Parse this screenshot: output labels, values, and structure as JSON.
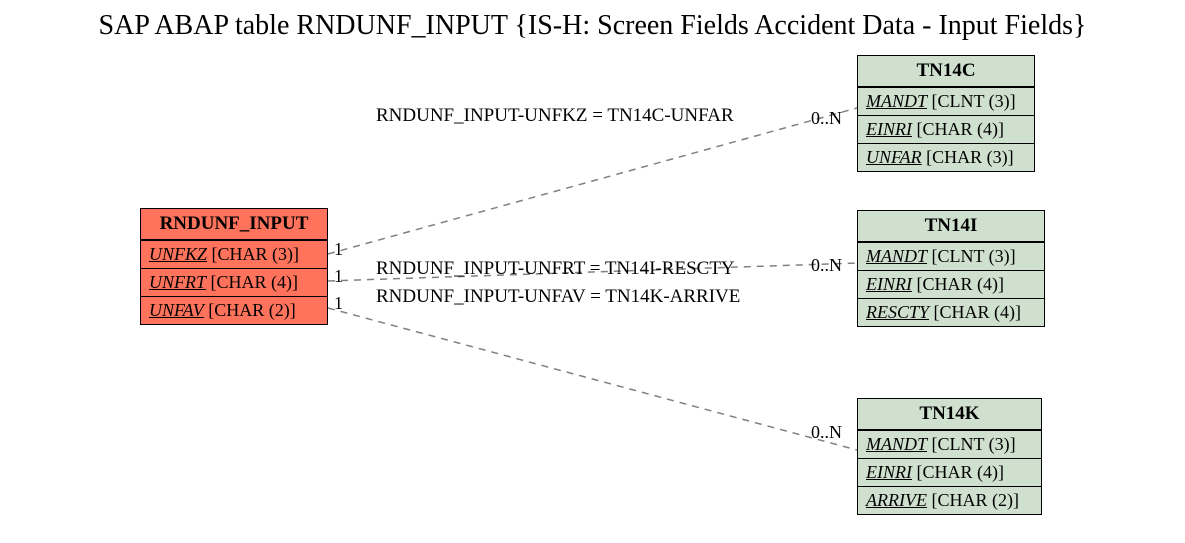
{
  "title": "SAP ABAP table RNDUNF_INPUT {IS-H: Screen Fields Accident Data - Input Fields}",
  "source": {
    "name": "RNDUNF_INPUT",
    "fields": [
      {
        "key": "UNFKZ",
        "type": "[CHAR (3)]",
        "keyfield": true
      },
      {
        "key": "UNFRT",
        "type": "[CHAR (4)]",
        "keyfield": true
      },
      {
        "key": "UNFAV",
        "type": "[CHAR (2)]",
        "keyfield": true
      }
    ]
  },
  "targets": [
    {
      "name": "TN14C",
      "fields": [
        {
          "key": "MANDT",
          "type": "[CLNT (3)]",
          "keyfield": true
        },
        {
          "key": "EINRI",
          "type": "[CHAR (4)]",
          "keyfield": true
        },
        {
          "key": "UNFAR",
          "type": "[CHAR (3)]",
          "keyfield": true
        }
      ]
    },
    {
      "name": "TN14I",
      "fields": [
        {
          "key": "MANDT",
          "type": "[CLNT (3)]",
          "keyfield": true
        },
        {
          "key": "EINRI",
          "type": "[CHAR (4)]",
          "keyfield": true
        },
        {
          "key": "RESCTY",
          "type": "[CHAR (4)]",
          "keyfield": true
        }
      ]
    },
    {
      "name": "TN14K",
      "fields": [
        {
          "key": "MANDT",
          "type": "[CLNT (3)]",
          "keyfield": true
        },
        {
          "key": "EINRI",
          "type": "[CHAR (4)]",
          "keyfield": true
        },
        {
          "key": "ARRIVE",
          "type": "[CHAR (2)]",
          "keyfield": true
        }
      ]
    }
  ],
  "relations": [
    {
      "label": "RNDUNF_INPUT-UNFKZ = TN14C-UNFAR",
      "left_card": "1",
      "right_card": "0..N"
    },
    {
      "label": "RNDUNF_INPUT-UNFRT = TN14I-RESCTY",
      "left_card": "1",
      "right_card": "0..N"
    },
    {
      "label": "RNDUNF_INPUT-UNFAV = TN14K-ARRIVE",
      "left_card": "1",
      "right_card": "0..N"
    }
  ],
  "chart_data": {
    "type": "table",
    "entities": [
      {
        "name": "RNDUNF_INPUT",
        "role": "source",
        "color": "#ff725c",
        "fields": [
          "UNFKZ CHAR(3)",
          "UNFRT CHAR(4)",
          "UNFAV CHAR(2)"
        ]
      },
      {
        "name": "TN14C",
        "role": "target",
        "color": "#cfe0cf",
        "fields": [
          "MANDT CLNT(3)",
          "EINRI CHAR(4)",
          "UNFAR CHAR(3)"
        ]
      },
      {
        "name": "TN14I",
        "role": "target",
        "color": "#cfe0cf",
        "fields": [
          "MANDT CLNT(3)",
          "EINRI CHAR(4)",
          "RESCTY CHAR(4)"
        ]
      },
      {
        "name": "TN14K",
        "role": "target",
        "color": "#cfe0cf",
        "fields": [
          "MANDT CLNT(3)",
          "EINRI CHAR(4)",
          "ARRIVE CHAR(2)"
        ]
      }
    ],
    "relations": [
      {
        "from": "RNDUNF_INPUT.UNFKZ",
        "to": "TN14C.UNFAR",
        "card_from": "1",
        "card_to": "0..N"
      },
      {
        "from": "RNDUNF_INPUT.UNFRT",
        "to": "TN14I.RESCTY",
        "card_from": "1",
        "card_to": "0..N"
      },
      {
        "from": "RNDUNF_INPUT.UNFAV",
        "to": "TN14K.ARRIVE",
        "card_from": "1",
        "card_to": "0..N"
      }
    ]
  }
}
